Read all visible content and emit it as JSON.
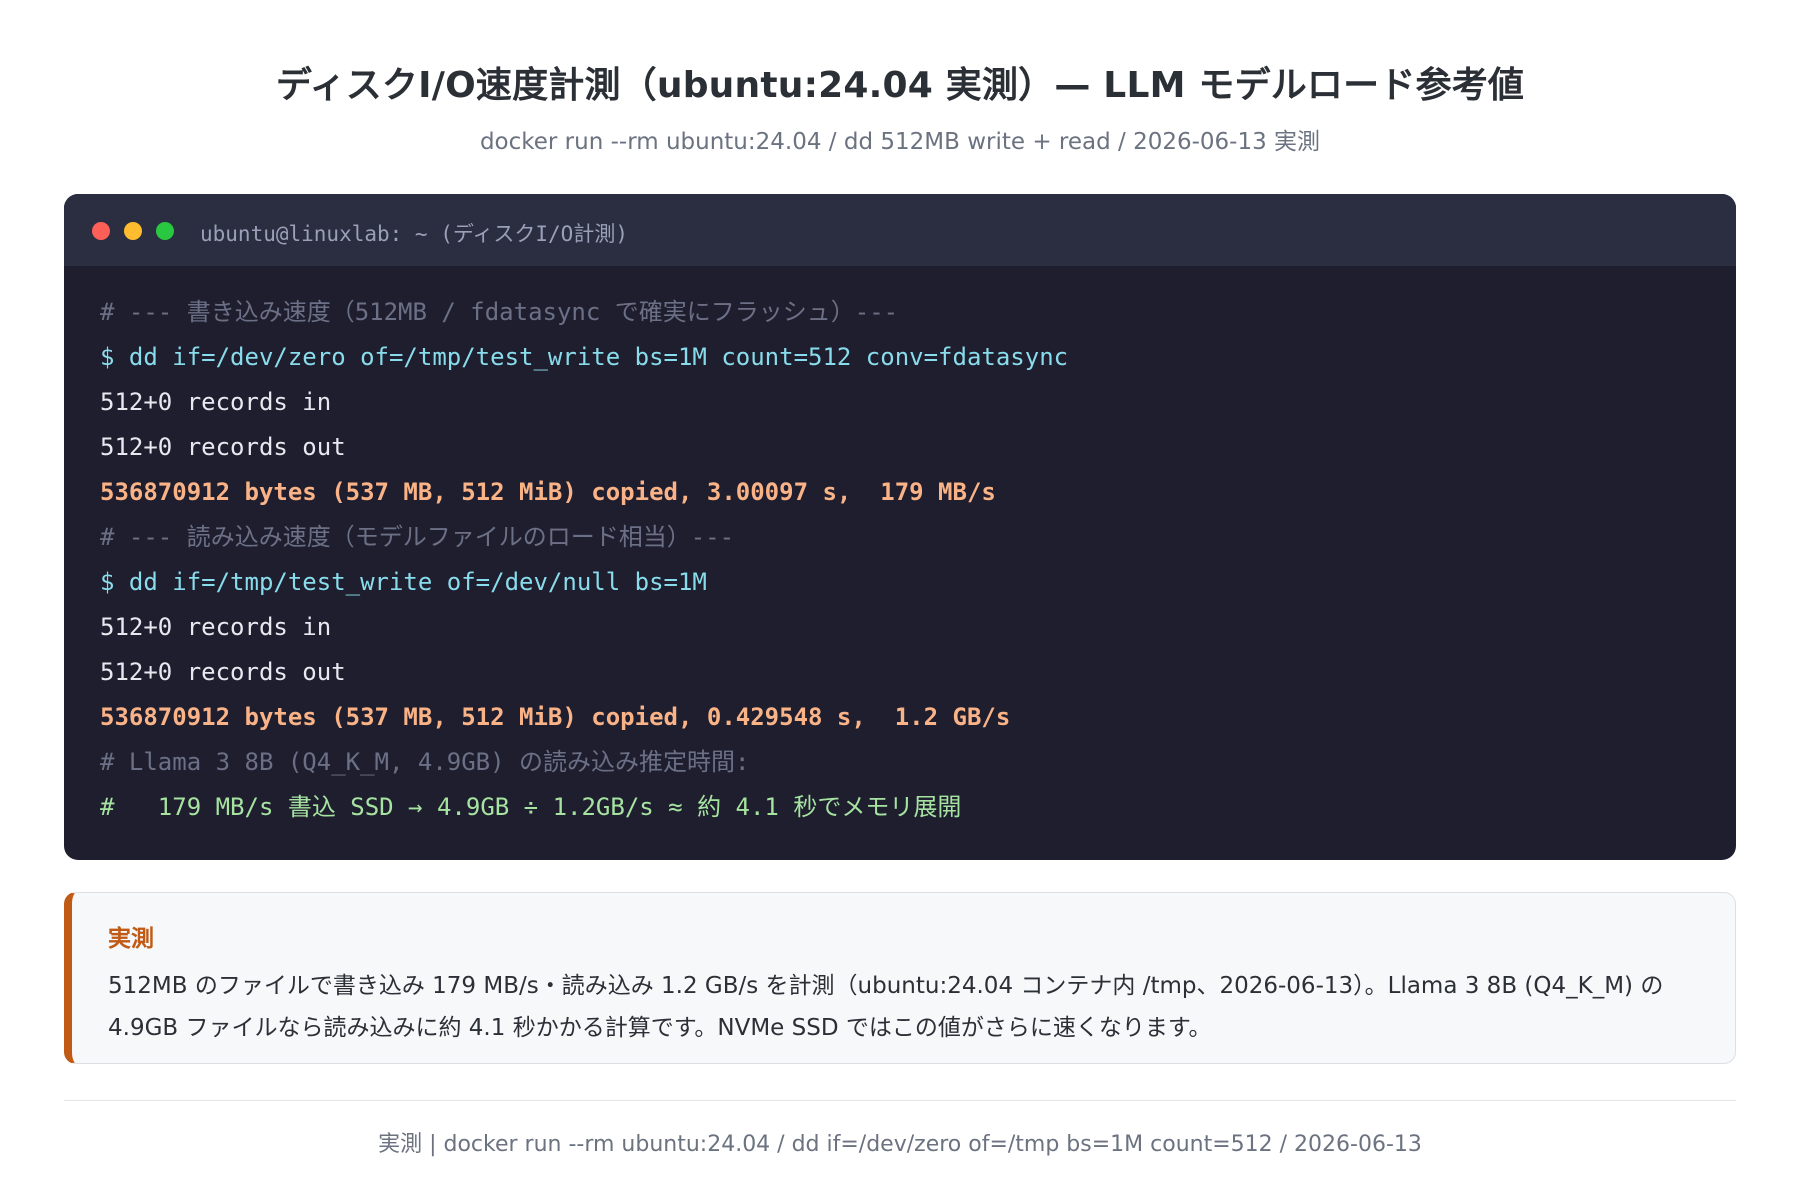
{
  "header": {
    "title": "ディスクI/O速度計測（ubuntu:24.04 実測）— LLM モデルロード参考値",
    "subtitle": "docker run --rm ubuntu:24.04 / dd 512MB write + read / 2026-06-13 実測"
  },
  "terminal": {
    "window_title": "ubuntu@linuxlab: ~ (ディスクI/O計測)",
    "window_buttons": [
      "close",
      "minimize",
      "maximize"
    ],
    "lines": [
      "# --- 書き込み速度（512MB / fdatasync で確実にフラッシュ）---",
      "$ dd if=/dev/zero of=/tmp/test_write bs=1M count=512 conv=fdatasync",
      "512+0 records in",
      "512+0 records out",
      "536870912 bytes (537 MB, 512 MiB) copied, 3.00097 s,  179 MB/s",
      "# --- 読み込み速度（モデルファイルのロード相当）---",
      "$ dd if=/tmp/test_write of=/dev/null bs=1M",
      "512+0 records in",
      "512+0 records out",
      "536870912 bytes (537 MB, 512 MiB) copied, 0.429548 s,  1.2 GB/s",
      "# Llama 3 8B (Q4_K_M, 4.9GB) の読み込み推定時間:",
      "#   179 MB/s 書込 SSD → 4.9GB ÷ 1.2GB/s ≈ 約 4.1 秒でメモリ展開"
    ]
  },
  "note": {
    "heading": "実測",
    "text": "512MB のファイルで書き込み 179 MB/s・読み込み 1.2 GB/s を計測（ubuntu:24.04 コンテナ内 /tmp、2026-06-13）。Llama 3 8B (Q4_K_M) の 4.9GB ファイルなら読み込みに約 4.1 秒かかる計算です。NVMe SSD ではこの値がさらに速くなります。"
  },
  "footer": {
    "text": "実測 | docker run --rm ubuntu:24.04 / dd if=/dev/zero of=/tmp bs=1M count=512 / 2026-06-13"
  },
  "colors": {
    "terminal_bg": "#1e1e2e",
    "terminal_header": "#2b2d40",
    "comment": "#6c7086",
    "command": "#89dceb",
    "output": "#e8e9f0",
    "result": "#fab387",
    "calc": "#a6e3a1",
    "accent": "#c05a14"
  }
}
